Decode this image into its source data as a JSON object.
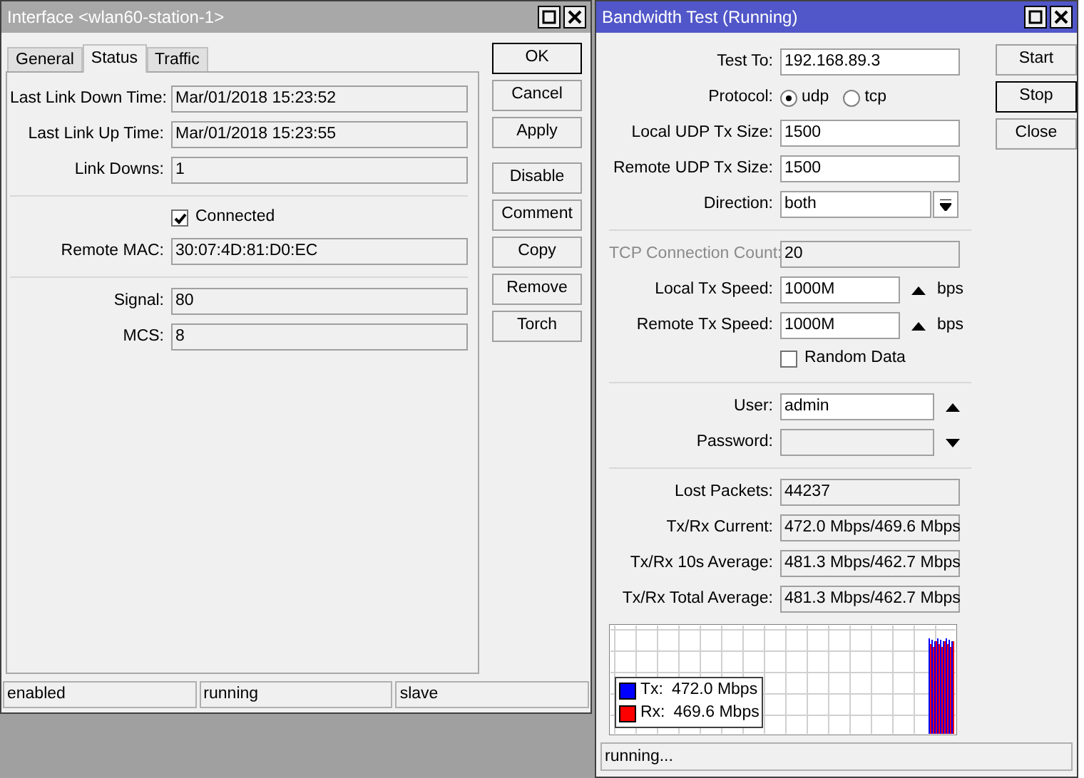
{
  "interface_window": {
    "title": "Interface <wlan60-station-1>",
    "active": false,
    "tabs": [
      {
        "label": "General",
        "selected": false
      },
      {
        "label": "Status",
        "selected": true
      },
      {
        "label": "Traffic",
        "selected": false
      }
    ],
    "fields": [
      {
        "kind": "readonly",
        "label": "Last Link Down Time:",
        "value": "Mar/01/2018 15:23:52"
      },
      {
        "kind": "readonly",
        "label": "Last Link Up Time:",
        "value": "Mar/01/2018 15:23:55"
      },
      {
        "kind": "readonly",
        "label": "Link Downs:",
        "value": "1"
      },
      {
        "kind": "separator"
      },
      {
        "kind": "checkbox",
        "label": "Connected",
        "checked": true
      },
      {
        "kind": "readonly",
        "label": "Remote MAC:",
        "value": "30:07:4D:81:D0:EC"
      },
      {
        "kind": "separator"
      },
      {
        "kind": "readonly",
        "label": "Signal:",
        "value": "80"
      },
      {
        "kind": "readonly",
        "label": "MCS:",
        "value": "8"
      }
    ],
    "button_groups": [
      [
        {
          "label": "OK",
          "focused": true
        },
        {
          "label": "Cancel",
          "focused": false
        },
        {
          "label": "Apply",
          "focused": false
        }
      ],
      [
        {
          "label": "Disable",
          "focused": false
        },
        {
          "label": "Comment",
          "focused": false
        },
        {
          "label": "Copy",
          "focused": false
        },
        {
          "label": "Remove",
          "focused": false
        },
        {
          "label": "Torch",
          "focused": false
        }
      ]
    ],
    "status_bar": [
      "enabled",
      "running",
      "slave"
    ]
  },
  "bandwidth_window": {
    "title": "Bandwidth Test (Running)",
    "active": true,
    "fields": [
      {
        "kind": "input",
        "label": "Test To:",
        "value": "192.168.89.3"
      },
      {
        "kind": "radio",
        "label": "Protocol:",
        "options": [
          {
            "label": "udp",
            "selected": true
          },
          {
            "label": "tcp",
            "selected": false
          }
        ]
      },
      {
        "kind": "input",
        "label": "Local UDP Tx Size:",
        "value": "1500"
      },
      {
        "kind": "input",
        "label": "Remote UDP Tx Size:",
        "value": "1500"
      },
      {
        "kind": "select",
        "label": "Direction:",
        "value": "both"
      },
      {
        "kind": "separator"
      },
      {
        "kind": "readonly",
        "label": "TCP Connection Count:",
        "value": "20",
        "disabled": true
      },
      {
        "kind": "input",
        "label": "Local Tx Speed:",
        "value": "1000M",
        "arrow_up": true,
        "unit": "bps"
      },
      {
        "kind": "input",
        "label": "Remote Tx Speed:",
        "value": "1000M",
        "arrow_up": true,
        "unit": "bps"
      },
      {
        "kind": "checkbox",
        "label": "Random Data",
        "checked": false
      },
      {
        "kind": "separator"
      },
      {
        "kind": "input",
        "label": "User:",
        "value": "admin",
        "arrow_up": true
      },
      {
        "kind": "readonly",
        "label": "Password:",
        "arrow_down": true
      },
      {
        "kind": "separator"
      },
      {
        "kind": "readonly",
        "label": "Lost Packets:",
        "value": "44237"
      },
      {
        "kind": "readonly",
        "label": "Tx/Rx Current:",
        "value": "472.0 Mbps/469.6 Mbps"
      },
      {
        "kind": "readonly",
        "label": "Tx/Rx 10s Average:",
        "value": "481.3 Mbps/462.7 Mbps"
      },
      {
        "kind": "readonly",
        "label": "Tx/Rx Total Average:",
        "value": "481.3 Mbps/462.7 Mbps"
      }
    ],
    "legend": [
      {
        "label": "Tx:",
        "value": "472.0 Mbps",
        "color": "#0000ff"
      },
      {
        "label": "Rx:",
        "value": "469.6 Mbps",
        "color": "#ff0000"
      }
    ],
    "buttons": [
      {
        "label": "Start",
        "focused": false
      },
      {
        "label": "Stop",
        "focused": true
      },
      {
        "label": "Close",
        "focused": false
      }
    ],
    "status_bar": [
      "running..."
    ]
  }
}
